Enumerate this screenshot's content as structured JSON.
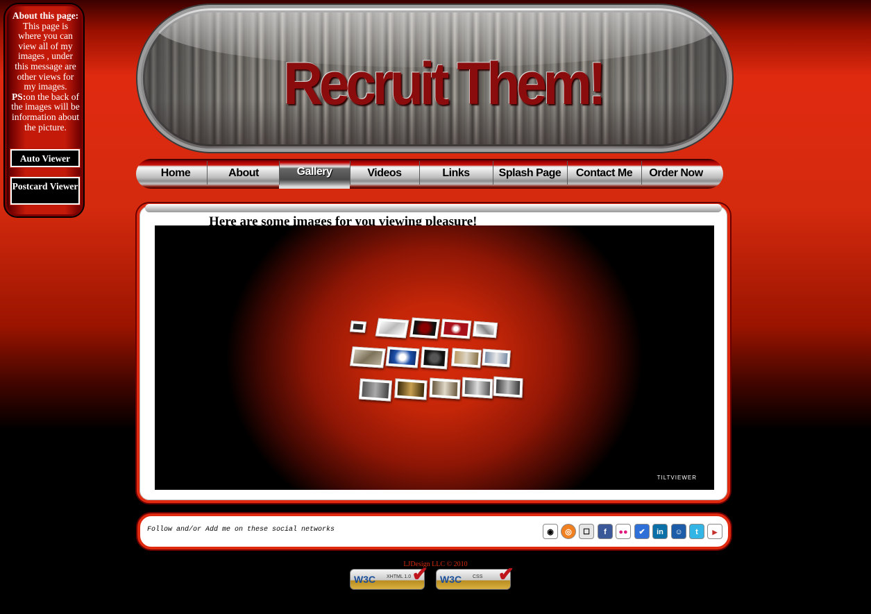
{
  "sidebar": {
    "about_heading": "About this page:",
    "about_text": "This page is where you can view all of my images , under this message are other views for my images.",
    "ps_label": "PS:",
    "ps_text": "on the back of the images will be information about the picture.",
    "auto_viewer_label": "Auto Viewer",
    "postcard_viewer_label": "Postcard Viewer"
  },
  "header": {
    "title": "Recruit Them!"
  },
  "nav": {
    "items": [
      {
        "label": "Home"
      },
      {
        "label": "About"
      },
      {
        "label": "Gallery",
        "active": true
      },
      {
        "label": "Videos"
      },
      {
        "label": "Links"
      },
      {
        "label": "Splash Page"
      },
      {
        "label": "Contact Me"
      },
      {
        "label": "Order Now"
      }
    ]
  },
  "main": {
    "heading": "Here are some images for you viewing pleasure!",
    "viewer": {
      "brand": "TILTVIEWER",
      "thumbnail_count": 15
    }
  },
  "social": {
    "caption": "Follow and/or Add me on these social networks",
    "icons": [
      {
        "name": "eye-icon",
        "color": "#ffffff"
      },
      {
        "name": "orange-circle-icon",
        "color": "#f08020"
      },
      {
        "name": "delicious-icon",
        "color": "#e6e6e6"
      },
      {
        "name": "facebook-icon",
        "color": "#3b5998"
      },
      {
        "name": "flickr-icon",
        "color": "#ffffff"
      },
      {
        "name": "checkmark-icon",
        "color": "#2f6fd8"
      },
      {
        "name": "linkedin-icon",
        "color": "#0b6fa8"
      },
      {
        "name": "myspace-icon",
        "color": "#1c5ca8"
      },
      {
        "name": "twitter-icon",
        "color": "#33b5e5"
      },
      {
        "name": "youtube-icon",
        "color": "#ffffff"
      }
    ]
  },
  "footer": {
    "copyright": "LJDesign LLC © 2010",
    "badge_xhtml": {
      "logo": "W3C",
      "text": "XHTML 1.0"
    },
    "badge_css": {
      "logo": "W3C",
      "text": "CSS"
    }
  },
  "colors": {
    "accent": "#e02a10",
    "dark_red": "#8a0c0c",
    "black": "#000000"
  }
}
